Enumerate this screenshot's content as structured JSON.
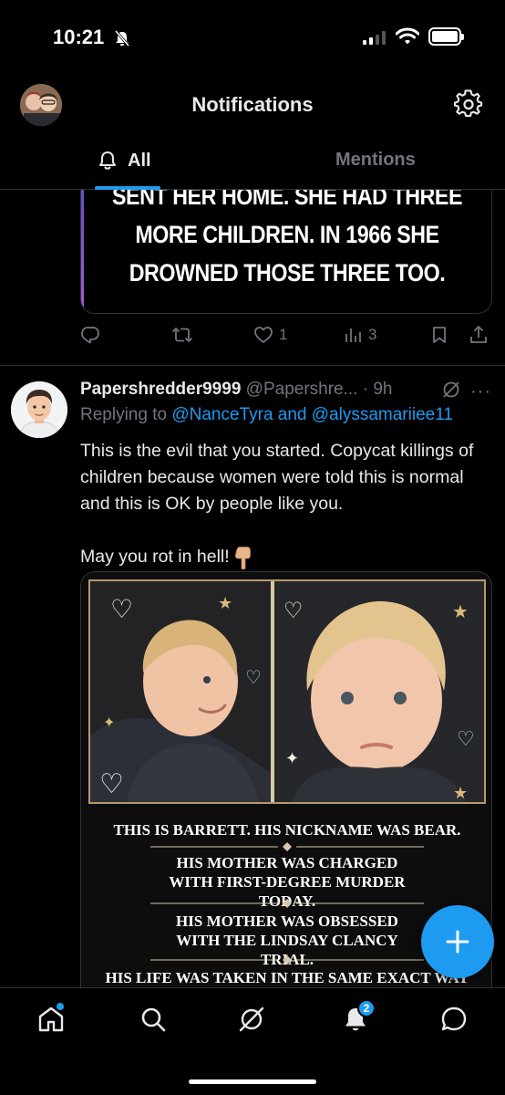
{
  "status_bar": {
    "time": "10:21"
  },
  "header": {
    "title": "Notifications"
  },
  "tabs": [
    {
      "label": "All",
      "active": true
    },
    {
      "label": "Mentions",
      "active": false
    }
  ],
  "previous_tweet": {
    "media_text_lines": [
      "SENT HER HOME. SHE HAD THREE",
      "MORE CHILDREN. IN 1966 SHE",
      "DROWNED THOSE THREE TOO."
    ],
    "likes": "1",
    "views": "3"
  },
  "tweet": {
    "display_name": "Papershredder9999",
    "handle_time": "@Papershre... · 9h",
    "replying_prefix": "Replying to",
    "replying_to": "@NanceTyra and @alyssamariiee11",
    "body_paragraph_1": "This is the evil that you started. Copycat killings of children because women were told this is normal and this is OK by people like you.",
    "body_paragraph_2": "May you rot in hell!",
    "media_captions": [
      "THIS IS BARRETT. HIS NICKNAME WAS BEAR.",
      "HIS MOTHER WAS CHARGED WITH FIRST-DEGREE MURDER TODAY.",
      "HIS MOTHER WAS OBSESSED WITH THE LINDSAY CLANCY TRIAL.",
      "HIS LIFE WAS TAKEN IN THE SAME EXACT WAY"
    ]
  },
  "bottom_nav": {
    "items": [
      "home-icon",
      "search-icon",
      "grok-icon",
      "notifications-icon",
      "messages-icon"
    ],
    "notifications_badge": "2"
  },
  "colors": {
    "accent": "#1d9bf0",
    "background": "#000000",
    "secondary_text": "#71767b",
    "border": "#2f3336"
  }
}
